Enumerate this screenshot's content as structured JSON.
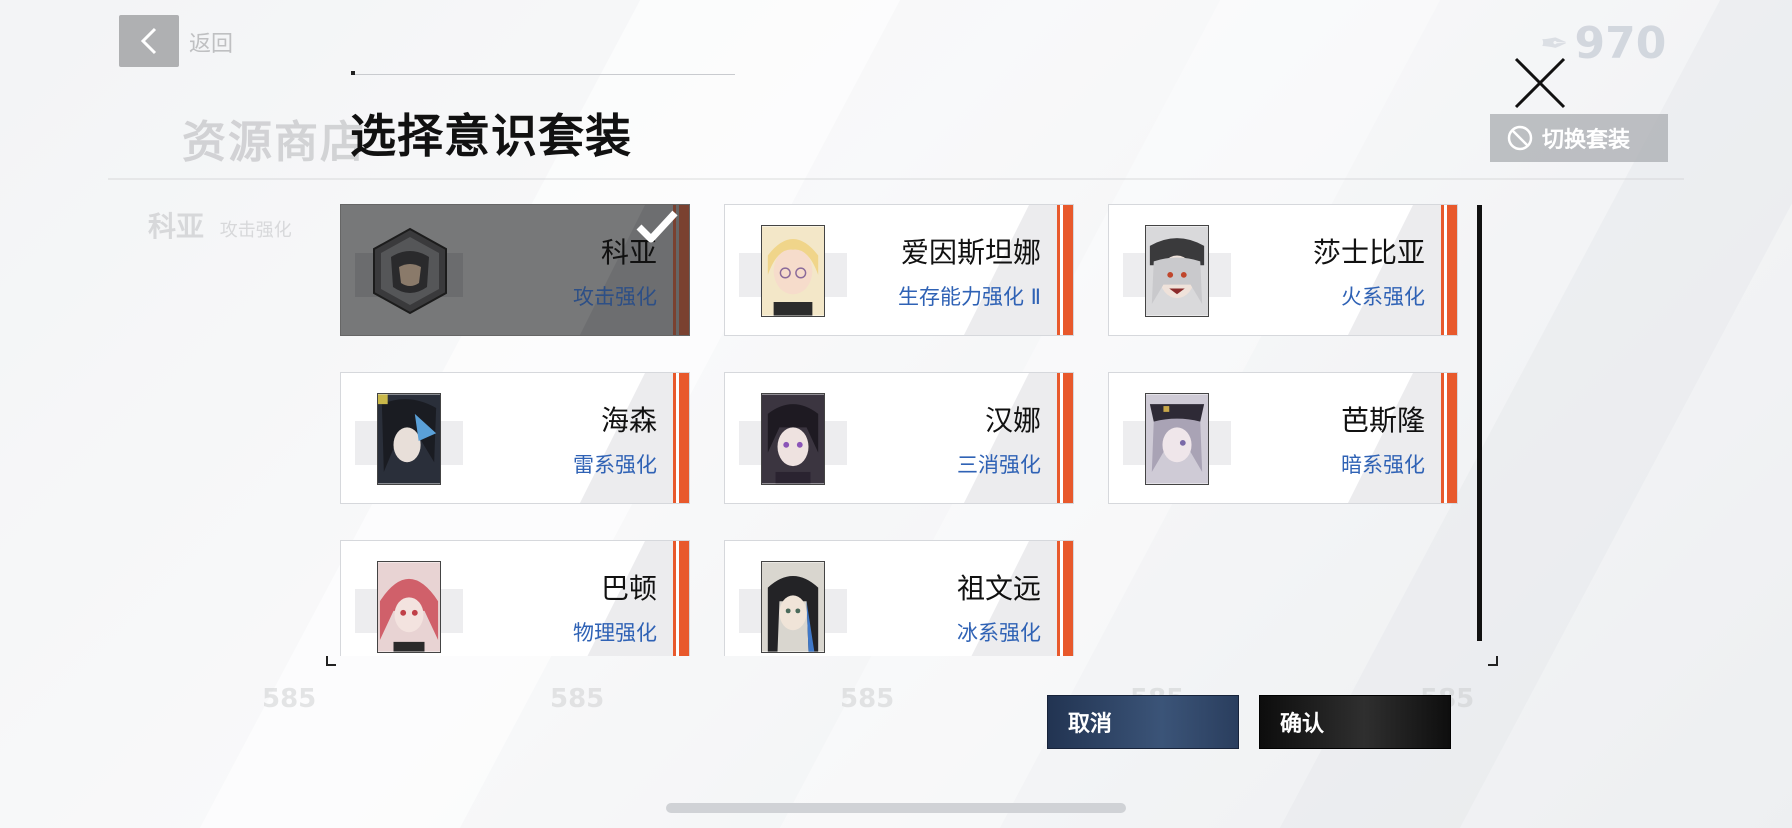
{
  "background": {
    "back_label": "返回",
    "page_title": "资源商店",
    "current_set_name": "科亚",
    "current_set_effect": "攻击强化",
    "currency_value": "970",
    "prices": [
      "585",
      "585",
      "585",
      "585",
      "585"
    ]
  },
  "modal": {
    "title": "选择意识套装",
    "switch_set_label": "切换套装",
    "cancel_label": "取消",
    "confirm_label": "确认"
  },
  "sets": [
    {
      "name": "科亚",
      "effect": "攻击强化",
      "selected": true
    },
    {
      "name": "爱因斯坦娜",
      "effect": "生存能力强化 Ⅱ",
      "selected": false
    },
    {
      "name": "莎士比亚",
      "effect": "火系强化",
      "selected": false
    },
    {
      "name": "海森",
      "effect": "雷系强化",
      "selected": false
    },
    {
      "name": "汉娜",
      "effect": "三消强化",
      "selected": false
    },
    {
      "name": "芭斯隆",
      "effect": "暗系强化",
      "selected": false
    },
    {
      "name": "巴顿",
      "effect": "物理强化",
      "selected": false
    },
    {
      "name": "祖文远",
      "effect": "冰系强化",
      "selected": false
    }
  ],
  "colors": {
    "accent_stripe": "#e8592c",
    "effect_text": "#2f62b5",
    "cancel_button": "#2f4668",
    "confirm_button": "#111111"
  },
  "icons": {
    "back": "chevron-left-icon",
    "close": "close-icon",
    "switch_set": "ban-icon",
    "selected": "check-icon",
    "currency": "quill-icon"
  }
}
